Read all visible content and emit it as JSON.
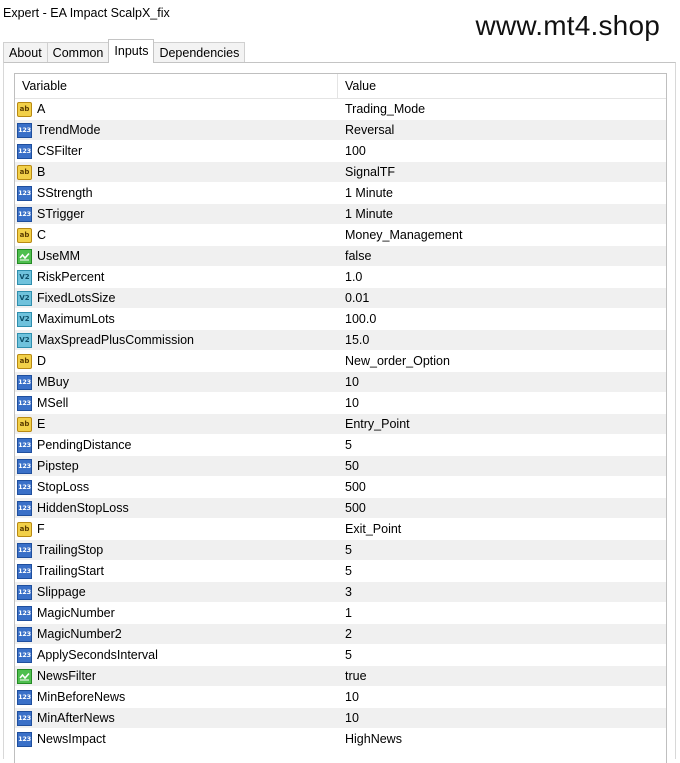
{
  "window": {
    "title": "Expert - EA Impact ScalpX_fix"
  },
  "watermark": "www.mt4.shop",
  "tabs": [
    {
      "label": "About",
      "active": false
    },
    {
      "label": "Common",
      "active": false
    },
    {
      "label": "Inputs",
      "active": true
    },
    {
      "label": "Dependencies",
      "active": false
    }
  ],
  "grid": {
    "columns": [
      "Variable",
      "Value"
    ],
    "rows": [
      {
        "icon": "string",
        "variable": "A",
        "value": "Trading_Mode"
      },
      {
        "icon": "int",
        "variable": "TrendMode",
        "value": "Reversal"
      },
      {
        "icon": "int",
        "variable": "CSFilter",
        "value": "100"
      },
      {
        "icon": "string",
        "variable": "B",
        "value": "SignalTF"
      },
      {
        "icon": "int",
        "variable": "SStrength",
        "value": "1 Minute"
      },
      {
        "icon": "int",
        "variable": "STrigger",
        "value": "1 Minute"
      },
      {
        "icon": "string",
        "variable": "C",
        "value": "Money_Management"
      },
      {
        "icon": "bool",
        "variable": "UseMM",
        "value": "false"
      },
      {
        "icon": "double",
        "variable": "RiskPercent",
        "value": "1.0"
      },
      {
        "icon": "double",
        "variable": "FixedLotsSize",
        "value": "0.01"
      },
      {
        "icon": "double",
        "variable": "MaximumLots",
        "value": "100.0"
      },
      {
        "icon": "double",
        "variable": "MaxSpreadPlusCommission",
        "value": "15.0"
      },
      {
        "icon": "string",
        "variable": "D",
        "value": "New_order_Option"
      },
      {
        "icon": "int",
        "variable": "MBuy",
        "value": "10"
      },
      {
        "icon": "int",
        "variable": "MSell",
        "value": "10"
      },
      {
        "icon": "string",
        "variable": "E",
        "value": "Entry_Point"
      },
      {
        "icon": "int",
        "variable": "PendingDistance",
        "value": "5"
      },
      {
        "icon": "int",
        "variable": "Pipstep",
        "value": "50"
      },
      {
        "icon": "int",
        "variable": "StopLoss",
        "value": "500"
      },
      {
        "icon": "int",
        "variable": "HiddenStopLoss",
        "value": "500"
      },
      {
        "icon": "string",
        "variable": "F",
        "value": "Exit_Point"
      },
      {
        "icon": "int",
        "variable": "TrailingStop",
        "value": "5"
      },
      {
        "icon": "int",
        "variable": "TrailingStart",
        "value": "5"
      },
      {
        "icon": "int",
        "variable": "Slippage",
        "value": "3"
      },
      {
        "icon": "int",
        "variable": "MagicNumber",
        "value": "1"
      },
      {
        "icon": "int",
        "variable": "MagicNumber2",
        "value": "2"
      },
      {
        "icon": "int",
        "variable": "ApplySecondsInterval",
        "value": "5"
      },
      {
        "icon": "bool",
        "variable": "NewsFilter",
        "value": "true"
      },
      {
        "icon": "int",
        "variable": "MinBeforeNews",
        "value": "10"
      },
      {
        "icon": "int",
        "variable": "MinAfterNews",
        "value": "10"
      },
      {
        "icon": "int",
        "variable": "NewsImpact",
        "value": "HighNews"
      }
    ]
  },
  "icon_glyphs": {
    "string": "ab",
    "int": "123",
    "double": "V2"
  }
}
